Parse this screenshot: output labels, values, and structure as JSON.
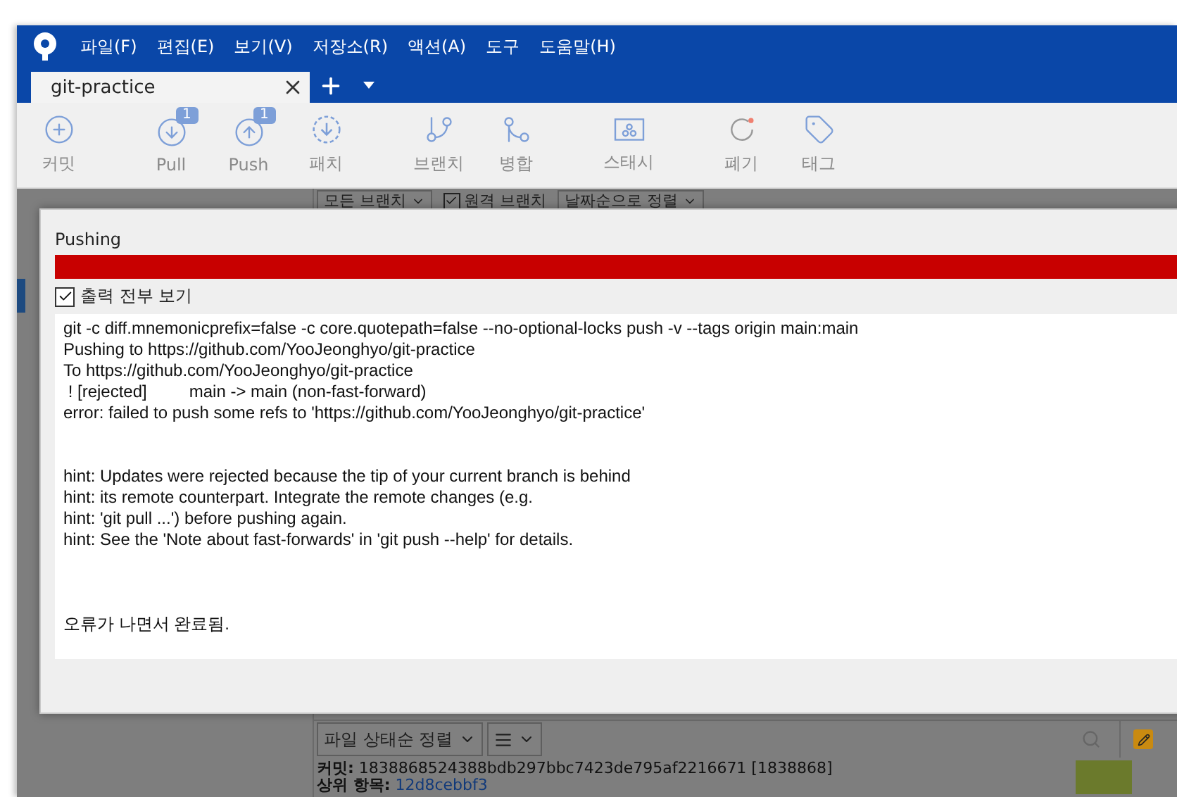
{
  "window": {
    "menu": [
      "파일(F)",
      "편집(E)",
      "보기(V)",
      "저장소(R)",
      "액션(A)",
      "도구",
      "도움말(H)"
    ]
  },
  "tabs": [
    {
      "label": "git-practice",
      "selected": true
    }
  ],
  "toolbar": {
    "groups": [
      [
        {
          "label": "커밋"
        }
      ],
      [
        {
          "label": "Pull",
          "badge": "1"
        },
        {
          "label": "Push",
          "badge": "1"
        },
        {
          "label": "패치"
        }
      ],
      [
        {
          "label": "브랜치"
        },
        {
          "label": "병합"
        }
      ],
      [
        {
          "label": "스태시"
        }
      ],
      [
        {
          "label": "폐기"
        },
        {
          "label": "태그"
        }
      ]
    ]
  },
  "branch_filter": {
    "branches": "모든 브랜치",
    "remote_branches": {
      "label": "원격 브랜치",
      "checked": true
    },
    "sort": "날짜순으로 정렬"
  },
  "dialog": {
    "title": "Pushing",
    "progress": {
      "level": 1
    },
    "show_full_output": {
      "label": "출력 전부 보기",
      "checked": true
    },
    "output_blocks": [
      [
        "git -c diff.mnemonicprefix=false -c core.quotepath=false --no-optional-locks push -v --tags origin main:main",
        "Pushing to https://github.com/YooJeonghyo/git-practice",
        "To https://github.com/YooJeonghyo/git-practice",
        " ! [rejected]         main -> main (non-fast-forward)",
        "error: failed to push some refs to 'https://github.com/YooJeonghyo/git-practice'"
      ],
      [
        "hint: Updates were rejected because the tip of your current branch is behind",
        "hint: its remote counterpart. Integrate the remote changes (e.g.",
        "hint: 'git pull ...') before pushing again.",
        "hint: See the 'Note about fast-forwards' in 'git push --help' for details."
      ],
      [
        "오류가 나면서 완료됨."
      ]
    ]
  },
  "file_panel": {
    "sort": "파일 상태순 정렬",
    "commit": {
      "label": "커밋:",
      "value": "1838868524388bdb297bbc7423de795af2216671 [1838868]"
    },
    "parent": {
      "label": "상위 항목:",
      "value": "12d8cebbf3"
    }
  }
}
